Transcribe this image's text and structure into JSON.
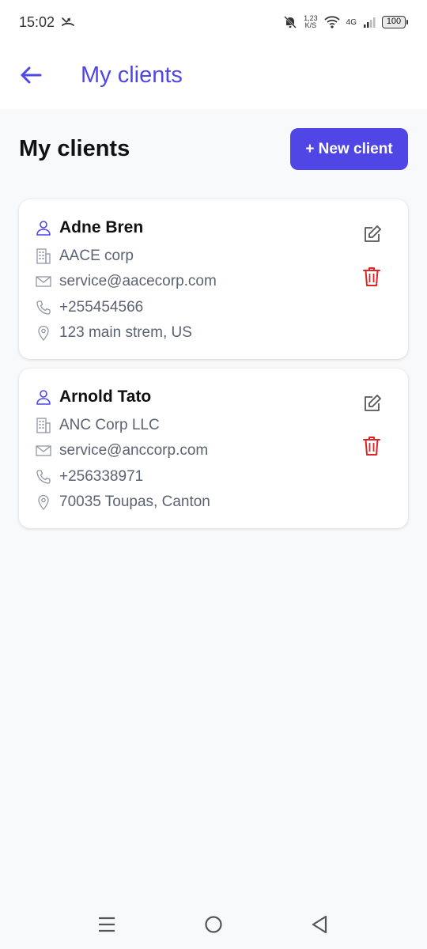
{
  "status_bar": {
    "time": "15:02",
    "net_speed_value": "1,23",
    "net_speed_unit": "K/S",
    "network_type": "4G",
    "battery": "100"
  },
  "app_bar": {
    "title": "My clients"
  },
  "page": {
    "heading": "My clients",
    "new_client_label": "+ New client"
  },
  "clients": [
    {
      "name": "Adne Bren",
      "company": "AACE corp",
      "email": "service@aacecorp.com",
      "phone": "+255454566",
      "address": "123 main strem, US"
    },
    {
      "name": "Arnold Tato",
      "company": "ANC Corp LLC",
      "email": "service@anccorp.com",
      "phone": "+256338971",
      "address": "70035 Toupas, Canton"
    }
  ],
  "colors": {
    "accent": "#4f46e5",
    "danger": "#dc2626",
    "muted_text": "#5b6271",
    "icon_gray": "#9097a3"
  },
  "icons": {
    "back": "arrow-left-icon",
    "person": "user-icon",
    "company": "building-icon",
    "email": "mail-icon",
    "phone": "phone-icon",
    "address": "map-pin-icon",
    "edit": "edit-icon",
    "delete": "trash-icon"
  }
}
